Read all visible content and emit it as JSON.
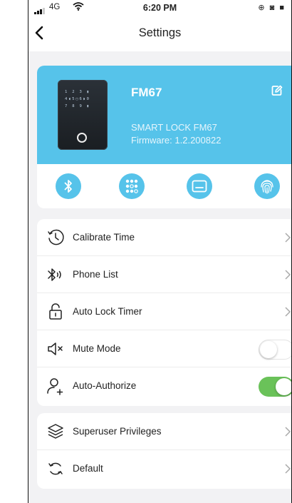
{
  "status_bar": {
    "network": "4G",
    "time": "6:20 PM",
    "icons": "⊕ ◙ ■"
  },
  "nav": {
    "title": "Settings",
    "back_icon": "chevron-left-icon"
  },
  "device": {
    "name": "FM67",
    "model": "SMART LOCK FM67",
    "firmware": "Firmware: 1.2.200822",
    "keypad_text": "1 2 3 🔒\n4 ◖5▢6◗ 0\n7 8 9 🔒",
    "accent_color": "#56c3ea",
    "features": [
      "bluetooth-icon",
      "keypad-icon",
      "card-icon",
      "fingerprint-icon"
    ]
  },
  "settings": {
    "items": [
      {
        "label": "Calibrate Time",
        "icon": "clock-icon",
        "control": "chevron"
      },
      {
        "label": "Phone List",
        "icon": "bluetooth-icon",
        "control": "chevron"
      },
      {
        "label": "Auto Lock Timer",
        "icon": "unlock-icon",
        "control": "chevron"
      },
      {
        "label": "Mute Mode",
        "icon": "mute-icon",
        "control": "toggle",
        "on": false
      },
      {
        "label": "Auto-Authorize",
        "icon": "add-user-icon",
        "control": "toggle",
        "on": true
      }
    ],
    "toggle_on_color": "#6ac259"
  },
  "advanced": {
    "items": [
      {
        "label": "Superuser Privileges",
        "icon": "layers-icon",
        "control": "chevron"
      },
      {
        "label": "Default",
        "icon": "reset-icon",
        "control": "chevron"
      }
    ]
  }
}
